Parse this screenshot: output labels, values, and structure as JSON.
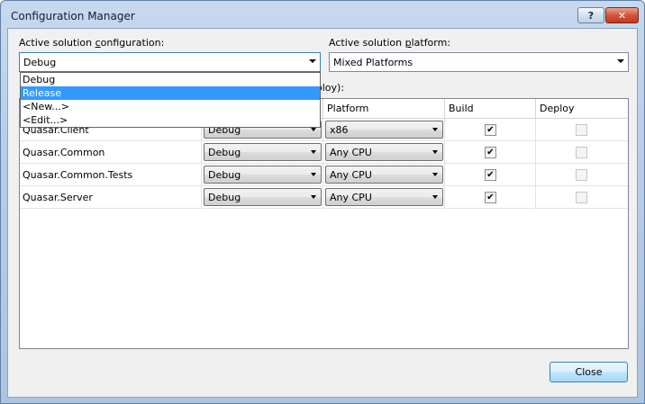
{
  "window": {
    "title": "Configuration Manager",
    "help_label": "?",
    "close_label": "✕"
  },
  "config": {
    "label_prefix": "Active solution ",
    "label_underlined": "c",
    "label_suffix": "onfiguration:",
    "value": "Debug",
    "options": [
      "Debug",
      "Release",
      "<New...>",
      "<Edit...>"
    ],
    "highlighted": "Release"
  },
  "platform": {
    "label_prefix": "Active solution ",
    "label_underlined": "p",
    "label_suffix": "latform:",
    "value": "Mixed Platforms"
  },
  "contexts_label_tail": "eploy):",
  "grid": {
    "headers": {
      "project": "",
      "configuration": "",
      "platform": "Platform",
      "build": "Build",
      "deploy": "Deploy"
    },
    "rows": [
      {
        "project": "Quasar.Client",
        "configuration": "Debug",
        "platform": "x86",
        "build": true,
        "deploy": false
      },
      {
        "project": "Quasar.Common",
        "configuration": "Debug",
        "platform": "Any CPU",
        "build": true,
        "deploy": false
      },
      {
        "project": "Quasar.Common.Tests",
        "configuration": "Debug",
        "platform": "Any CPU",
        "build": true,
        "deploy": false
      },
      {
        "project": "Quasar.Server",
        "configuration": "Debug",
        "platform": "Any CPU",
        "build": true,
        "deploy": false
      }
    ]
  },
  "buttons": {
    "close": "Close"
  },
  "colors": {
    "selection": "#3399ff",
    "accent": "#3c7fb1"
  }
}
